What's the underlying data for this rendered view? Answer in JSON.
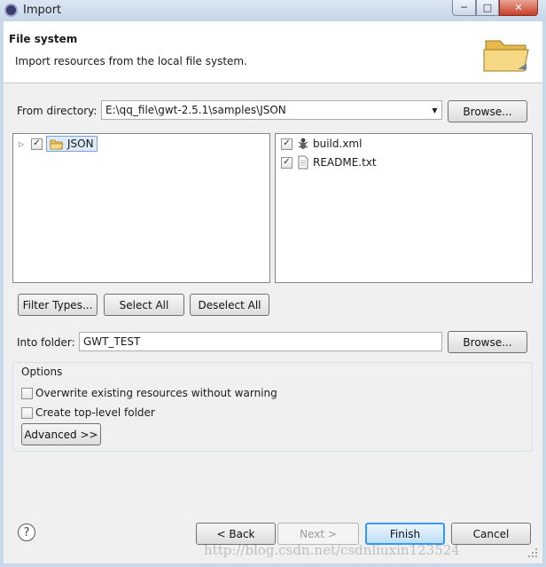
{
  "window": {
    "title": "Import",
    "minimize_glyph": "─",
    "maximize_glyph": "□",
    "close_glyph": "✕"
  },
  "header": {
    "title": "File system",
    "description": "Import resources from the local file system."
  },
  "from_directory": {
    "label": "From directory:",
    "value": "E:\\qq_file\\gwt-2.5.1\\samples\\JSON",
    "browse_label": "Browse..."
  },
  "tree": {
    "items": [
      {
        "label": "JSON",
        "checked": true,
        "icon": "folder-open-icon"
      }
    ]
  },
  "files": {
    "items": [
      {
        "label": "build.xml",
        "checked": true,
        "icon": "ant-file-icon"
      },
      {
        "label": "README.txt",
        "checked": true,
        "icon": "text-file-icon"
      }
    ]
  },
  "buttons": {
    "filter_types": "Filter Types...",
    "select_all": "Select All",
    "deselect_all": "Deselect All",
    "back": "< Back",
    "next": "Next >",
    "finish": "Finish",
    "cancel": "Cancel",
    "help": "?"
  },
  "into_folder": {
    "label": "Into folder:",
    "value": "GWT_TEST",
    "browse_label": "Browse..."
  },
  "options": {
    "title": "Options",
    "overwrite_label": "Overwrite existing resources without warning",
    "overwrite_checked": false,
    "top_level_label": "Create top-level folder",
    "top_level_checked": false,
    "advanced_label": "Advanced >>"
  },
  "watermark": "http://blog.csdn.net/csdnliuxin123524",
  "colors": {
    "finish_border": "#3399ff",
    "close_button": "#c8402a"
  }
}
